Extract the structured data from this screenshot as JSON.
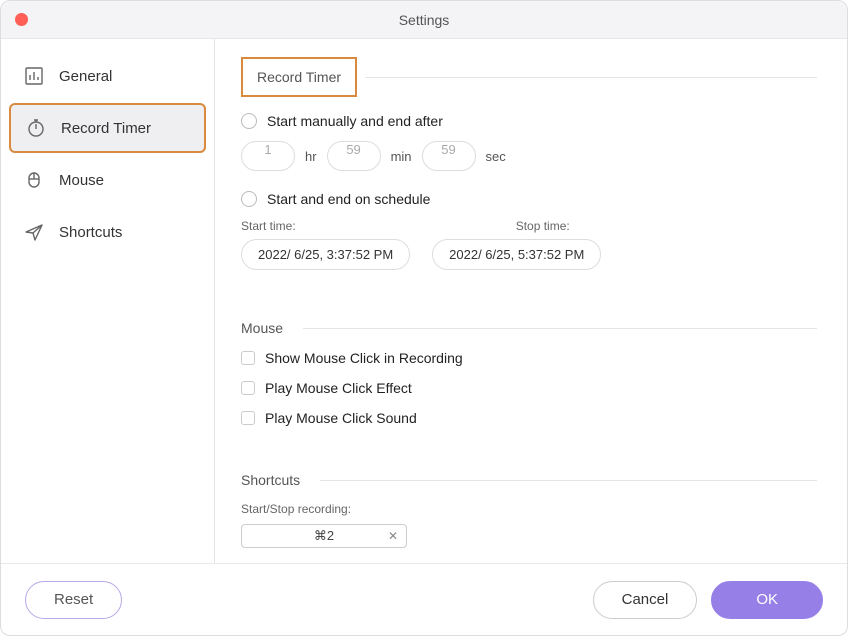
{
  "window": {
    "title": "Settings"
  },
  "sidebar": {
    "items": [
      {
        "label": "General"
      },
      {
        "label": "Record Timer"
      },
      {
        "label": "Mouse"
      },
      {
        "label": "Shortcuts"
      }
    ]
  },
  "recordTimer": {
    "sectionTitle": "Record Timer",
    "startManualLabel": "Start manually and end after",
    "hrValue": "1",
    "hrUnit": "hr",
    "minValue": "59",
    "minUnit": "min",
    "secValue": "59",
    "secUnit": "sec",
    "scheduleLabel": "Start and end on schedule",
    "startTimeLabel": "Start time:",
    "stopTimeLabel": "Stop time:",
    "startTimeValue": "2022/  6/25,   3:37:52 PM",
    "stopTimeValue": "2022/  6/25,   5:37:52 PM"
  },
  "mouse": {
    "sectionTitle": "Mouse",
    "opt1": "Show Mouse Click in Recording",
    "opt2": "Play Mouse Click Effect",
    "opt3": "Play Mouse Click Sound"
  },
  "shortcuts": {
    "sectionTitle": "Shortcuts",
    "startStopLabel": "Start/Stop recording:",
    "startStopValue": "⌘2"
  },
  "footer": {
    "reset": "Reset",
    "cancel": "Cancel",
    "ok": "OK"
  }
}
